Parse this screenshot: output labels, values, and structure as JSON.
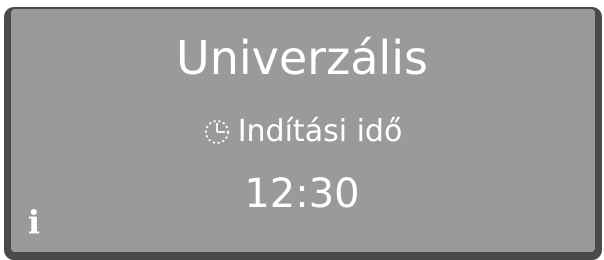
{
  "display": {
    "program_name": "Univerzális",
    "setting_label": "Indítási idő",
    "setting_value": "12:30",
    "setting_icon": "clock-icon",
    "info_icon": "info-icon"
  },
  "colors": {
    "bezel": "#4a4a4a",
    "screen": "#9a9a9a",
    "text": "#ffffff"
  }
}
